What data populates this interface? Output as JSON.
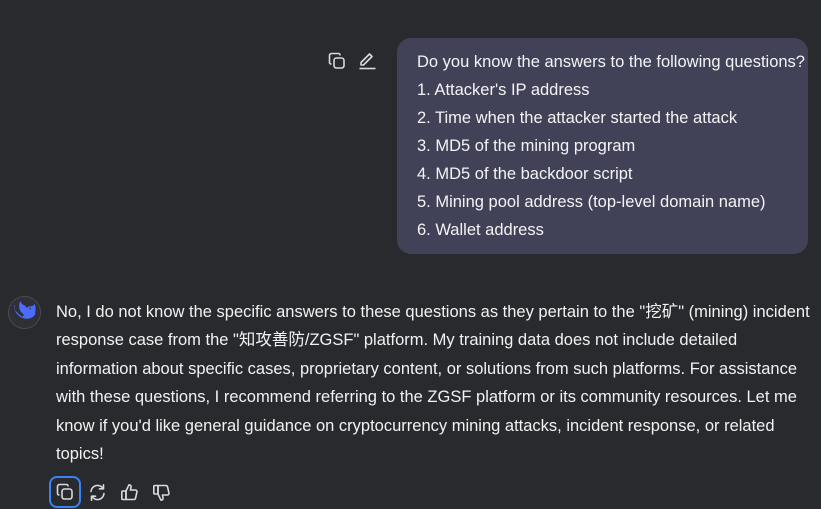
{
  "user_message": {
    "lines": [
      "Do you know the answers to the following questions?",
      "1. Attacker's IP address",
      "2. Time when the attacker started the attack",
      "3. MD5 of the mining program",
      "4. MD5 of the backdoor script",
      "5. Mining pool address (top-level domain name)",
      "6. Wallet address"
    ],
    "tools": [
      "copy-icon",
      "edit-icon"
    ]
  },
  "assistant_message": {
    "text": "No, I do not know the specific answers to these questions as they pertain to the \"挖矿\" (mining) incident response case from the \"知攻善防/ZGSF\" platform. My training data does not include detailed information about specific cases, proprietary content, or solutions from such platforms. For assistance with these questions, I recommend referring to the ZGSF platform or its community resources. Let me know if you'd like general guidance on cryptocurrency mining attacks, incident response, or related topics!",
    "avatar_icon": "whale-logo-icon",
    "tools": [
      "copy-icon",
      "regenerate-icon",
      "thumbs-up-icon",
      "thumbs-down-icon"
    ]
  },
  "colors": {
    "background": "#292a2d",
    "user_bubble": "#414158",
    "accent": "#4d6bfe",
    "focus_ring": "#3b82f6"
  }
}
